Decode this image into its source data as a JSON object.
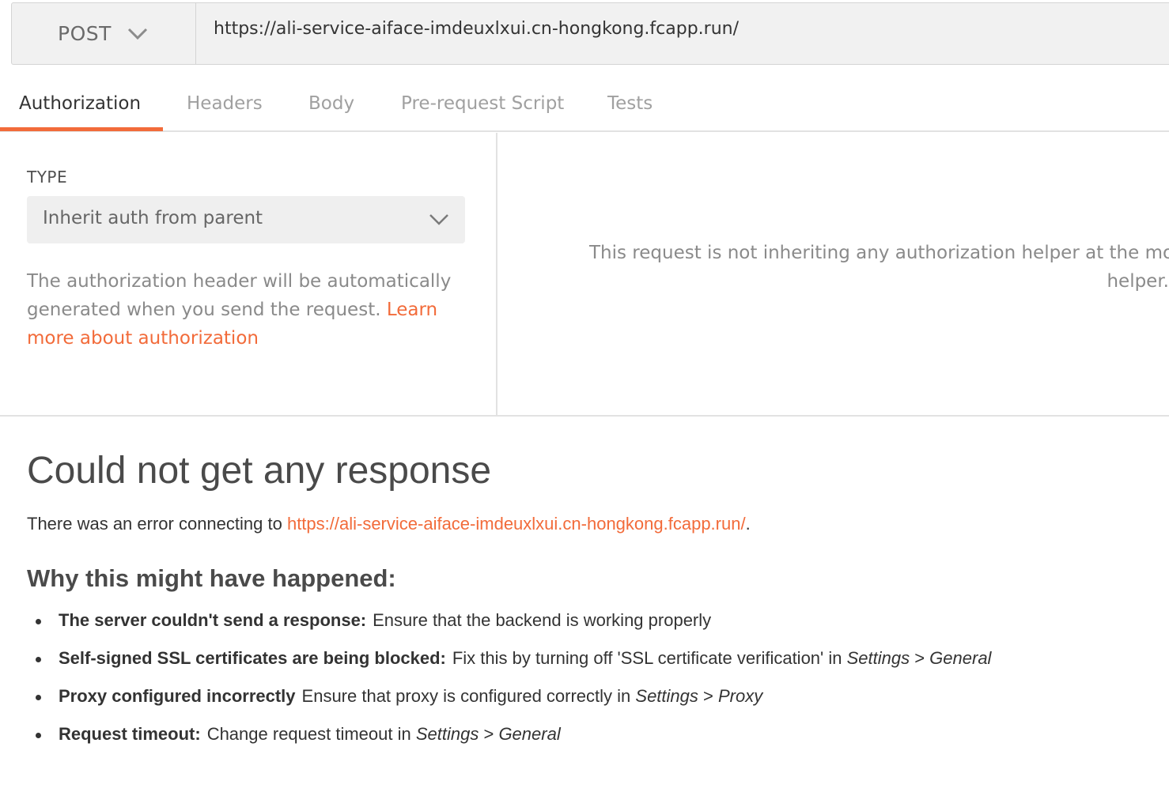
{
  "request": {
    "method": "POST",
    "url": "https://ali-service-aiface-imdeuxlxui.cn-hongkong.fcapp.run/"
  },
  "tabs": [
    {
      "label": "Authorization",
      "active": true
    },
    {
      "label": "Headers"
    },
    {
      "label": "Body"
    },
    {
      "label": "Pre-request Script"
    },
    {
      "label": "Tests"
    }
  ],
  "auth": {
    "type_label": "TYPE",
    "type_value": "Inherit auth from parent",
    "description": "The authorization header will be automatically generated when you send the request.",
    "learn_link": "Learn more about authorization",
    "inherit_message_line1": "This request is not inheriting any authorization helper at the mom",
    "inherit_message_line2": "helper."
  },
  "response": {
    "title": "Could not get any response",
    "error_prefix": "There was an error connecting to ",
    "error_url": "https://ali-service-aiface-imdeuxlxui.cn-hongkong.fcapp.run/",
    "error_suffix": ".",
    "why_heading": "Why this might have happened:",
    "reasons": [
      {
        "title": "The server couldn't send a response:",
        "text": "Ensure that the backend is working properly",
        "path": []
      },
      {
        "title": "Self-signed SSL certificates are being blocked:",
        "text": "Fix this by turning off 'SSL certificate verification' in ",
        "path": [
          "Settings",
          "General"
        ]
      },
      {
        "title": "Proxy configured incorrectly",
        "text": "Ensure that proxy is configured correctly in ",
        "path": [
          "Settings",
          "Proxy"
        ]
      },
      {
        "title": "Request timeout:",
        "text": "Change request timeout in ",
        "path": [
          "Settings",
          "General"
        ]
      }
    ],
    "path_separator": " > "
  },
  "colors": {
    "accent": "#f26b3a",
    "text": "#333333",
    "muted": "#8a8a8a",
    "border": "#e2e2e2"
  }
}
